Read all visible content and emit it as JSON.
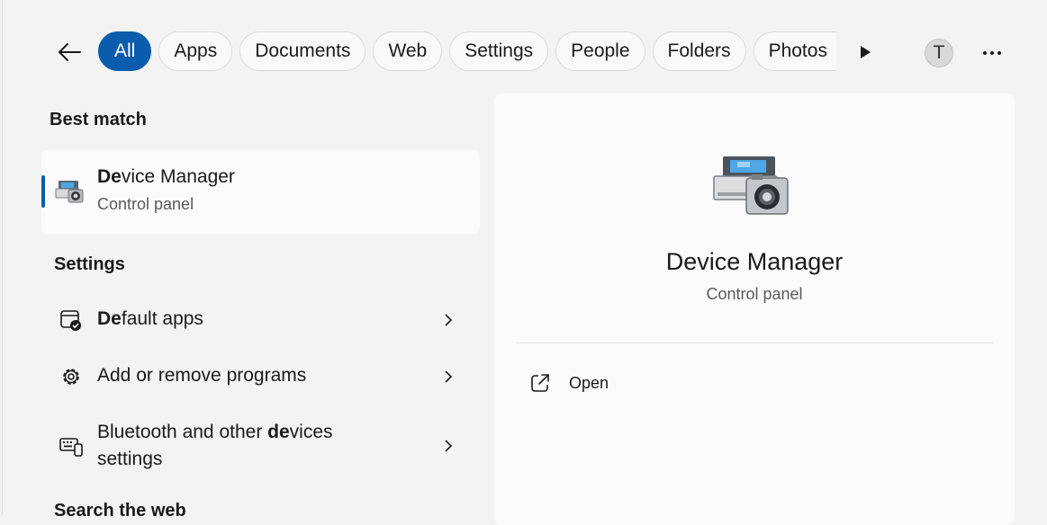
{
  "toolbar": {
    "filters": [
      "All",
      "Apps",
      "Documents",
      "Web",
      "Settings",
      "People",
      "Folders",
      "Photos"
    ],
    "active_filter": "All",
    "avatar_initial": "T"
  },
  "results": {
    "best_match_header": "Best match",
    "best_match": {
      "title_bold": "De",
      "title_rest": "vice Manager",
      "subtitle": "Control panel",
      "icon": "device-manager-icon"
    },
    "settings_header": "Settings",
    "settings_items": [
      {
        "bold": "De",
        "rest": "fault apps",
        "icon": "default-apps-icon"
      },
      {
        "pre": "Add or remove programs",
        "icon": "gear-icon"
      },
      {
        "pre": "Bluetooth and other ",
        "bold": "de",
        "rest": "vices",
        "line2": "settings",
        "icon": "devices-icon"
      }
    ],
    "web_header": "Search the web"
  },
  "detail": {
    "title": "Device Manager",
    "subtitle": "Control panel",
    "actions": [
      {
        "label": "Open",
        "icon": "open-external-icon"
      }
    ]
  },
  "colors": {
    "accent": "#0b5cad",
    "background": "#f3f3f3",
    "card": "#fbfbfb"
  }
}
